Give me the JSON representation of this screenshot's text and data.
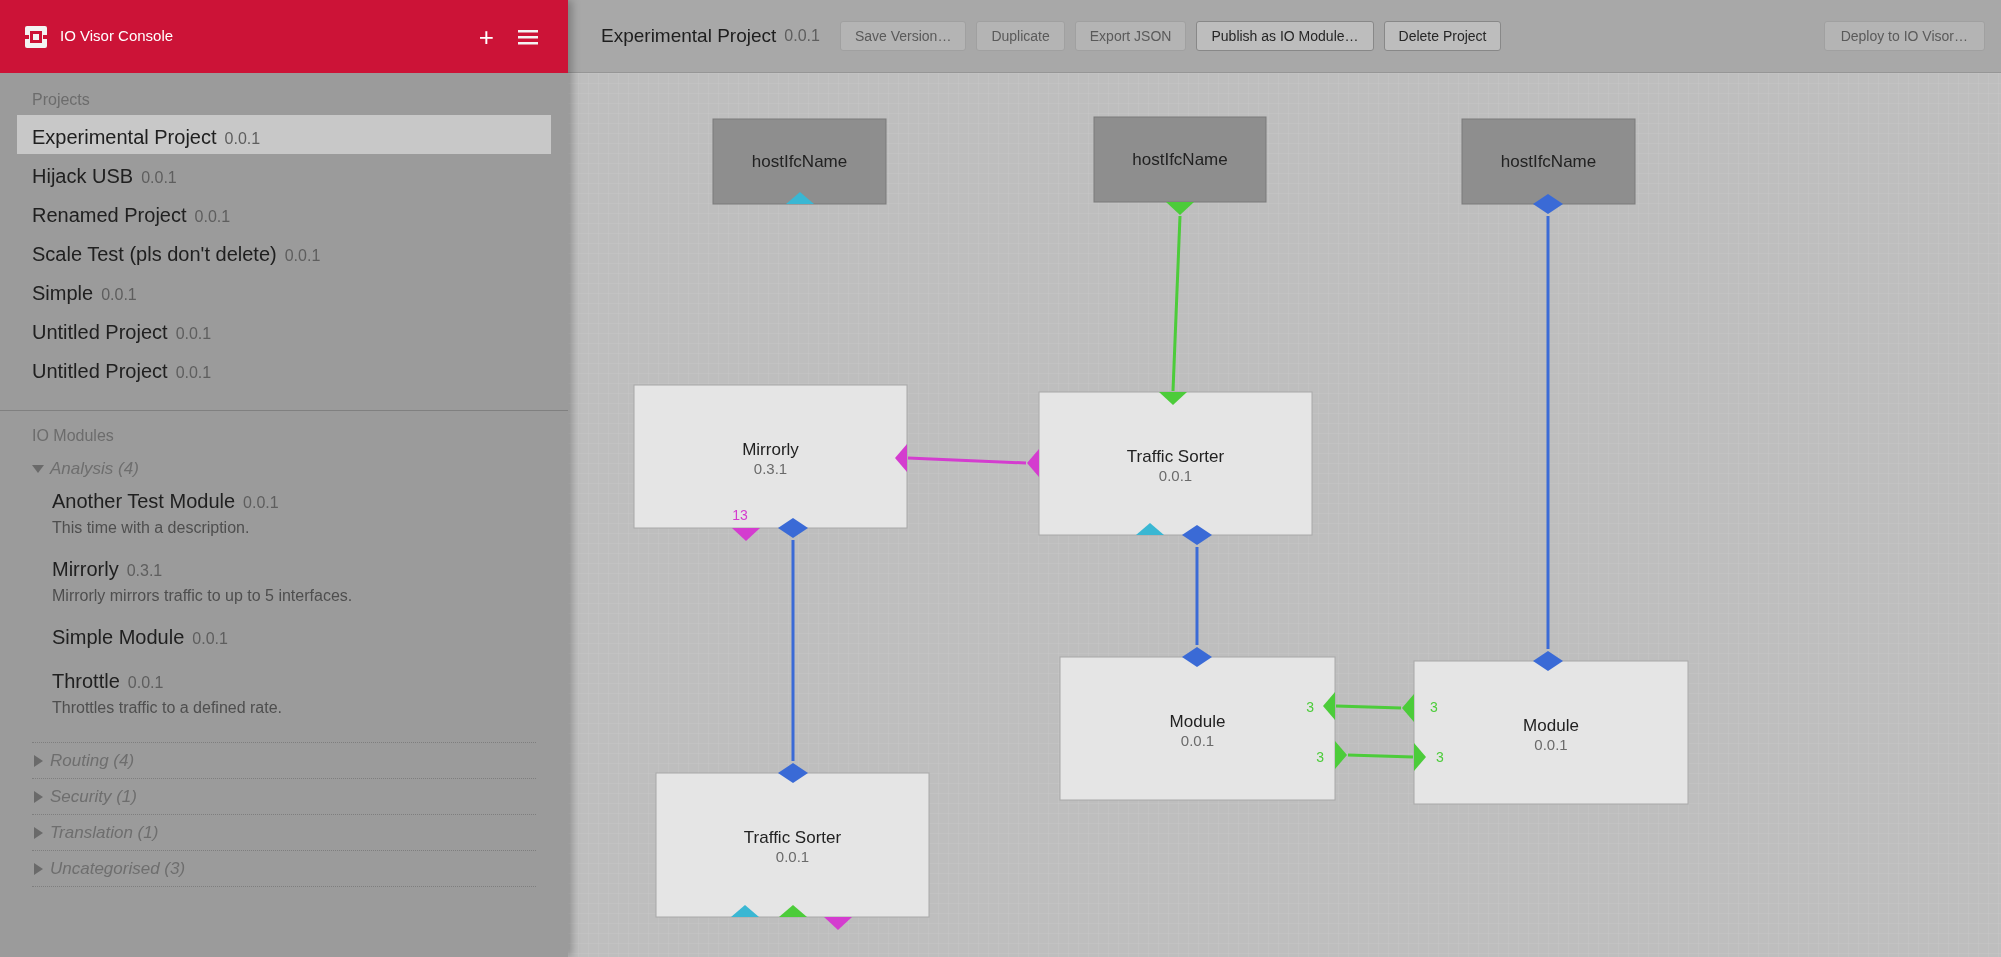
{
  "app": {
    "title": "IO Visor Console",
    "add_symbol": "+"
  },
  "projects": {
    "heading": "Projects",
    "items": [
      {
        "name": "Experimental Project",
        "version": "0.0.1",
        "selected": true
      },
      {
        "name": "Hijack USB",
        "version": "0.0.1",
        "selected": false
      },
      {
        "name": "Renamed Project",
        "version": "0.0.1",
        "selected": false
      },
      {
        "name": "Scale Test (pls don't delete)",
        "version": "0.0.1",
        "selected": false
      },
      {
        "name": "Simple",
        "version": "0.0.1",
        "selected": false
      },
      {
        "name": "Untitled Project",
        "version": "0.0.1",
        "selected": false
      },
      {
        "name": "Untitled Project",
        "version": "0.0.1",
        "selected": false
      }
    ]
  },
  "io_modules": {
    "heading": "IO Modules",
    "categories": [
      {
        "name": "Analysis (4)",
        "expanded": true,
        "modules": [
          {
            "name": "Another Test Module",
            "version": "0.0.1",
            "description": "This time with a description."
          },
          {
            "name": "Mirrorly",
            "version": "0.3.1",
            "description": "Mirrorly mirrors traffic to up to 5 interfaces."
          },
          {
            "name": "Simple Module",
            "version": "0.0.1"
          },
          {
            "name": "Throttle",
            "version": "0.0.1",
            "description": "Throttles traffic to a defined rate."
          }
        ]
      },
      {
        "name": "Routing (4)",
        "expanded": false
      },
      {
        "name": "Security (1)",
        "expanded": false
      },
      {
        "name": "Translation (1)",
        "expanded": false
      },
      {
        "name": "Uncategorised (3)",
        "expanded": false
      }
    ]
  },
  "toolbar": {
    "project_name": "Experimental Project",
    "project_version": "0.0.1",
    "buttons": [
      {
        "label": "Save Version…",
        "disabled": true
      },
      {
        "label": "Duplicate",
        "disabled": true
      },
      {
        "label": "Export JSON",
        "disabled": true
      },
      {
        "label": "Publish as IO Module…",
        "disabled": false
      },
      {
        "label": "Delete Project",
        "disabled": false
      }
    ],
    "deploy_button": {
      "label": "Deploy to IO Visor…",
      "disabled": true
    }
  },
  "canvas": {
    "nodes": [
      {
        "kind": "interface",
        "name": "hostIfcName"
      },
      {
        "kind": "interface",
        "name": "hostIfcName"
      },
      {
        "kind": "interface",
        "name": "hostIfcName"
      },
      {
        "kind": "module",
        "name": "Mirrorly",
        "version": "0.3.1"
      },
      {
        "kind": "module",
        "name": "Traffic Sorter",
        "version": "0.0.1"
      },
      {
        "kind": "module",
        "name": "Module",
        "version": "0.0.1"
      },
      {
        "kind": "module",
        "name": "Module",
        "version": "0.0.1"
      },
      {
        "kind": "module",
        "name": "Traffic Sorter",
        "version": "0.0.1"
      }
    ],
    "ports": [
      {
        "color": "#3ab7d3"
      },
      {
        "color": "#4ccc3a"
      },
      {
        "color": "#3a6ad6"
      },
      {
        "color": "#d43ccf"
      },
      {
        "color": "#d43ccf",
        "label": "13"
      },
      {
        "color": "#3a6ad6"
      },
      {
        "color": "#4ccc3a"
      },
      {
        "color": "#d43ccf"
      },
      {
        "color": "#3ab7d3"
      },
      {
        "color": "#3a6ad6"
      },
      {
        "color": "#3a6ad6"
      },
      {
        "color": "#3ab7d3"
      },
      {
        "color": "#4ccc3a"
      },
      {
        "color": "#d43ccf"
      },
      {
        "color": "#3a6ad6"
      },
      {
        "color": "#4ccc3a",
        "label": "3"
      },
      {
        "color": "#4ccc3a",
        "label": "3"
      },
      {
        "color": "#3a6ad6"
      },
      {
        "color": "#4ccc3a",
        "label": "3"
      },
      {
        "color": "#4ccc3a",
        "label": "3"
      }
    ],
    "links": [
      {
        "color": "#4ccc3a"
      },
      {
        "color": "#3a6ad6"
      },
      {
        "color": "#d43ccf"
      },
      {
        "color": "#3a6ad6"
      },
      {
        "color": "#3a6ad6"
      },
      {
        "color": "#4ccc3a"
      },
      {
        "color": "#4ccc3a"
      }
    ]
  }
}
